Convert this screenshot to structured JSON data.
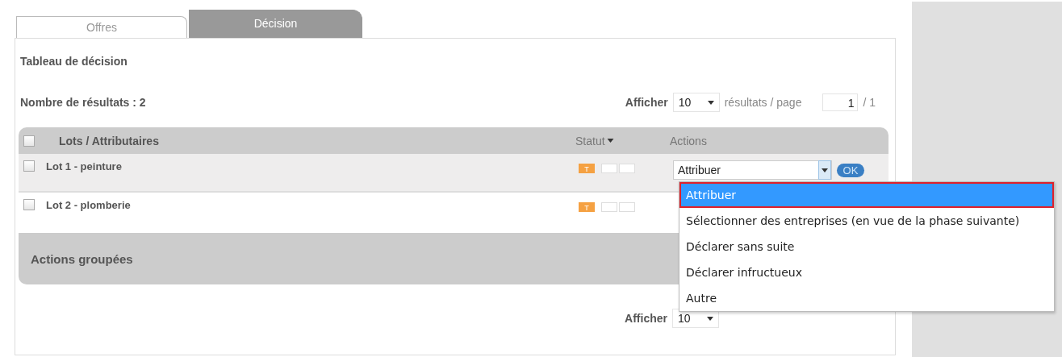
{
  "tabs": [
    {
      "label": "Offres",
      "selected": false
    },
    {
      "label": "Décision",
      "selected": true
    }
  ],
  "title": "Tableau de décision",
  "result_count": "Nombre de résultats : 2",
  "pager_top": {
    "show_label": "Afficher",
    "page_size": "10",
    "per_page_label": "résultats / page",
    "page": "1",
    "total": "/ 1"
  },
  "table": {
    "select_all_checked": false,
    "columns": [
      "Lots / Attributaires",
      "Statut",
      "Actions"
    ],
    "rows": [
      {
        "label": "Lot 1 - peinture",
        "checked": false,
        "status": [
          {
            "label": "T",
            "on": true
          },
          {
            "on": false
          },
          {
            "on": false
          }
        ],
        "action": {
          "value": "Attribuer",
          "button": "OK"
        }
      },
      {
        "label": "Lot 2 - plomberie",
        "checked": false,
        "status": [
          {
            "label": "T",
            "on": true
          },
          {
            "on": false
          },
          {
            "on": false
          }
        ]
      }
    ]
  },
  "group_actions": "Actions groupées",
  "pager_bottom": {
    "show_label": "Afficher",
    "page_size": "10"
  },
  "dropdown": [
    {
      "label": "Attribuer",
      "selected": true
    },
    {
      "label": "Sélectionner des entreprises (en vue de la phase suivante)",
      "selected": false
    },
    {
      "label": "Déclarer sans suite",
      "selected": false
    },
    {
      "label": "Déclarer infructueux",
      "selected": false
    },
    {
      "label": "Autre",
      "selected": false
    }
  ]
}
